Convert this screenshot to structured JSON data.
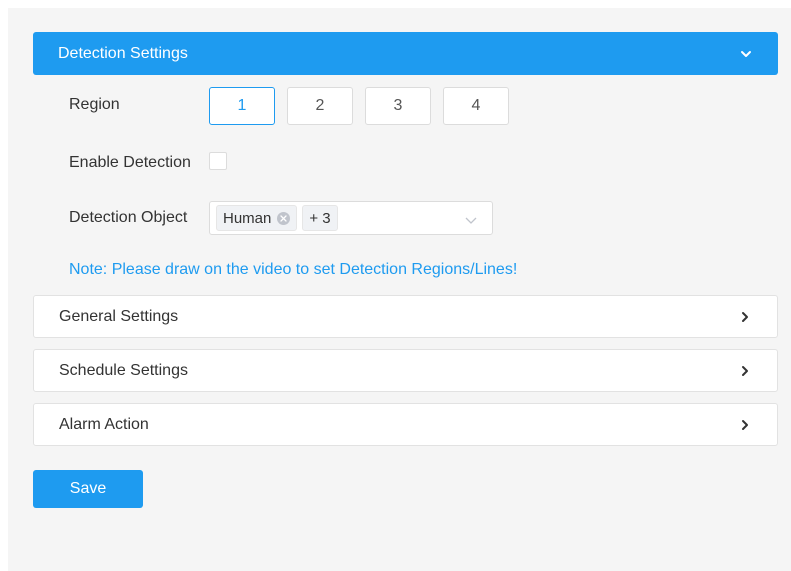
{
  "detection_settings": {
    "title": "Detection Settings",
    "region_label": "Region",
    "regions": [
      "1",
      "2",
      "3",
      "4"
    ],
    "selected_region": "1",
    "enable_label": "Enable Detection",
    "enable_checked": false,
    "object_label": "Detection Object",
    "object_tags": [
      "Human"
    ],
    "object_more": "+ 3",
    "note": "Note: Please draw on the video to set Detection Regions/Lines!"
  },
  "sections": [
    {
      "title": "General Settings"
    },
    {
      "title": "Schedule Settings"
    },
    {
      "title": "Alarm Action"
    }
  ],
  "save_label": "Save",
  "colors": {
    "accent": "#1e9bf0",
    "background": "#f5f5f5"
  }
}
